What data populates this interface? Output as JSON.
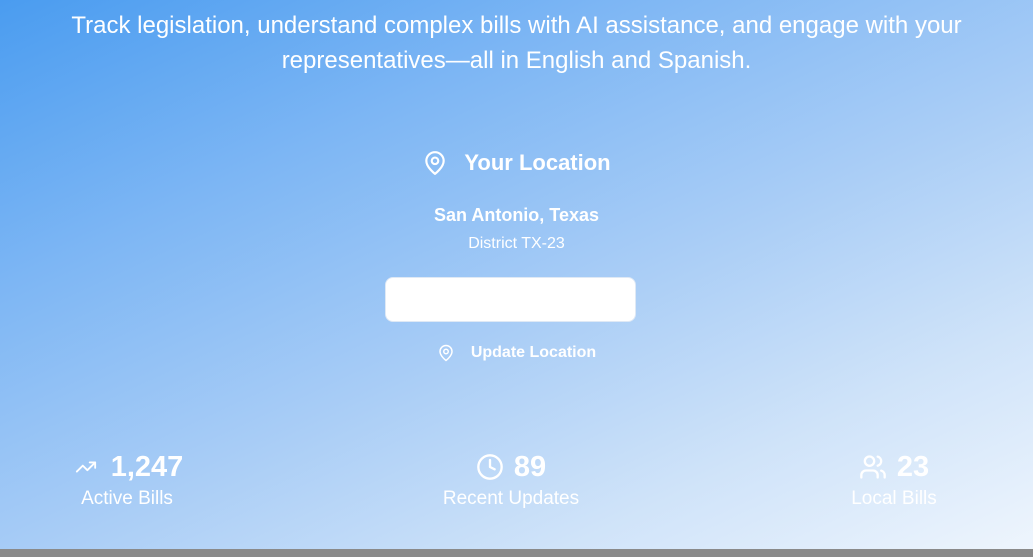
{
  "hero": {
    "tagline": "Track legislation, understand complex bills with AI assistance, and engage with your representatives—all in English and Spanish."
  },
  "location": {
    "header_icon": "map-pin-icon",
    "title": "Your Location",
    "city": "San Antonio, Texas",
    "district": "District TX-23",
    "input_value": "",
    "update_icon": "map-pin-icon",
    "update_label": "Update Location"
  },
  "stats": [
    {
      "icon": "trending-up-icon",
      "value": "1,247",
      "label": "Active Bills"
    },
    {
      "icon": "clock-icon",
      "value": "89",
      "label": "Recent Updates"
    },
    {
      "icon": "users-icon",
      "value": "23",
      "label": "Local Bills"
    }
  ],
  "colors": {
    "gradient_start": "#4a9cf0",
    "gradient_end": "#eef5fd",
    "text": "#ffffff"
  }
}
